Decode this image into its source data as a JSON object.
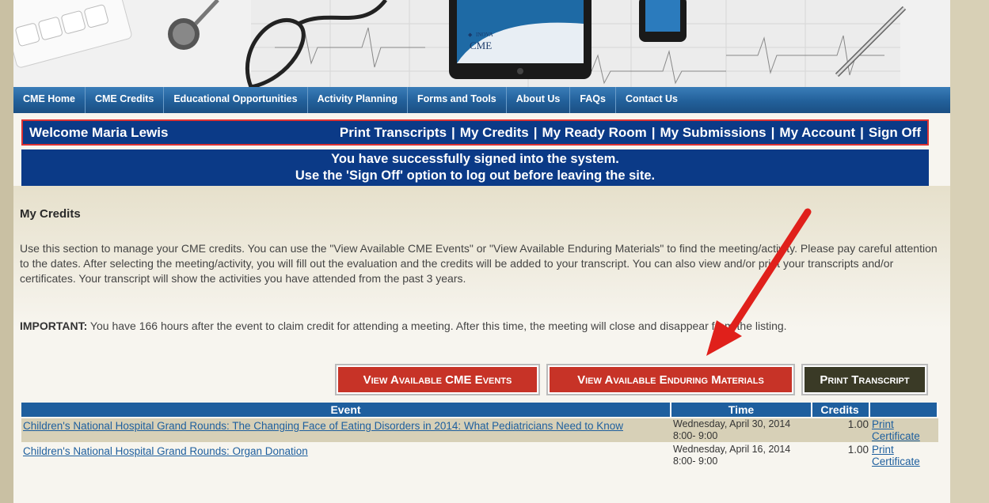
{
  "header": {
    "tablet_brand": "INOVA",
    "tablet_label": "CME"
  },
  "nav": {
    "items": [
      {
        "label": "CME Home"
      },
      {
        "label": "CME Credits"
      },
      {
        "label": "Educational Opportunities"
      },
      {
        "label": "Activity Planning"
      },
      {
        "label": "Forms and Tools"
      },
      {
        "label": "About Us"
      },
      {
        "label": "FAQs"
      },
      {
        "label": "Contact Us"
      }
    ]
  },
  "welcome": {
    "greeting": "Welcome Maria Lewis",
    "links": [
      "Print Transcripts",
      "My Credits",
      "My Ready Room",
      "My Submissions",
      "My Account",
      "Sign Off"
    ],
    "separator": "|"
  },
  "success": {
    "line1": "You have successfully signed into the system.",
    "line2": "Use the 'Sign Off' option to log out before leaving the site."
  },
  "main": {
    "title": "My Credits",
    "intro": "Use this section to manage your CME credits. You can use the \"View Available CME Events\" or \"View Available Enduring Materials\" to find the meeting/activity. Please pay careful attention to the dates. After selecting the meeting/activity, you will fill out the evaluation and the credits will be added to your transcript. You can also view and/or print your transcripts and/or certificates. Your transcript will show the activities you have attended from the past 3 years.",
    "important_label": "IMPORTANT:",
    "important_text": " You have 166 hours after the event to claim credit for attending a meeting. After this time, the meeting will close and disappear from the listing."
  },
  "buttons": {
    "cme_events": "View Available CME Events",
    "enduring": "View Available Enduring Materials",
    "transcript": "Print Transcript"
  },
  "table": {
    "headers": [
      "Event",
      "Time",
      "Credits",
      ""
    ],
    "rows": [
      {
        "event": "Children's National Hospital Grand Rounds: The Changing Face of Eating Disorders in 2014: What Pediatricians Need to Know",
        "date": "Wednesday, April 30, 2014",
        "time": "8:00- 9:00",
        "credits": "1.00",
        "action": "Print Certificate"
      },
      {
        "event": "Children's National Hospital Grand Rounds: Organ Donation",
        "date": "Wednesday, April 16, 2014",
        "time": "8:00- 9:00",
        "credits": "1.00",
        "action": "Print Certificate"
      }
    ]
  },
  "colors": {
    "nav_blue": "#22609a",
    "banner_blue": "#0b3a87",
    "button_red": "#c73327",
    "button_dark": "#3a3a26",
    "arrow_red": "#e0201b"
  }
}
